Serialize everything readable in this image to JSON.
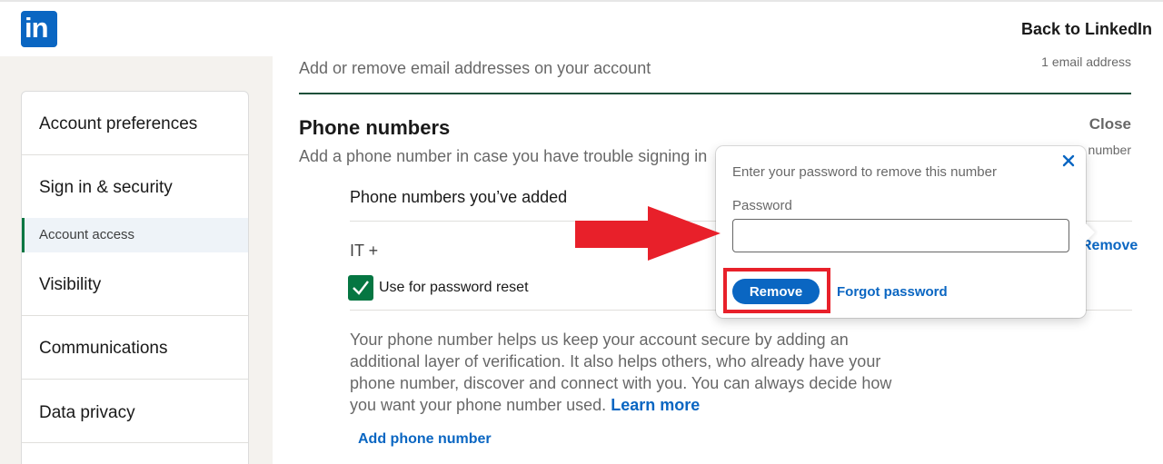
{
  "header": {
    "logo_text": "in",
    "back_link": "Back to LinkedIn"
  },
  "sidebar": {
    "items": [
      {
        "label": "Account preferences"
      },
      {
        "label": "Sign in & security"
      },
      {
        "label": "Account access"
      },
      {
        "label": "Visibility"
      },
      {
        "label": "Communications"
      },
      {
        "label": "Data privacy"
      }
    ]
  },
  "main": {
    "email_desc": "Add or remove email addresses on your account",
    "email_count": "1 email address",
    "phone_title": "Phone numbers",
    "close_label": "Close",
    "phone_desc": "Add a phone number in case you have trouble signing in",
    "phone_count": "number",
    "added_title": "Phone numbers you’ve added",
    "phone_entry": "IT +",
    "remove_label": "Remove",
    "reset_checkbox_label": "Use for password reset",
    "reset_checked": true,
    "info_text": "Your phone number helps us keep your account secure by adding an additional layer of verification. It also helps others, who already have your phone number, discover and connect with you. You can always decide how you want your phone number used.",
    "learn_more": "Learn more",
    "add_phone": "Add phone number"
  },
  "popup": {
    "prompt": "Enter your password to remove this number",
    "password_label": "Password",
    "password_value": "",
    "remove_button": "Remove",
    "forgot_link": "Forgot password"
  },
  "annotations": {
    "arrow_color": "#e8202a",
    "highlight_color": "#e8202a"
  }
}
